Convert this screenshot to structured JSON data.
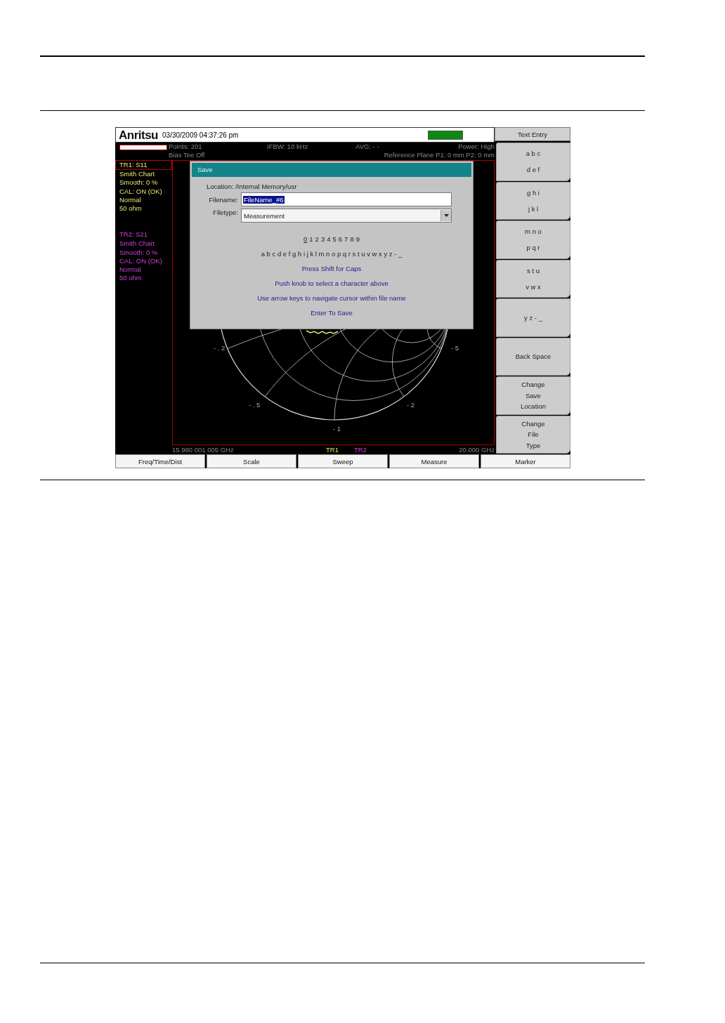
{
  "header": {
    "logo": "Anritsu",
    "datetime": "03/30/2009 04:37:26 pm"
  },
  "status": {
    "points": "Points: 201",
    "ifbw": "IFBW: 10 kHz",
    "avg": "AVG: - -",
    "power": "Power: High",
    "bias": "Bias Tee Off",
    "reference": "Reference Plane P1: 0 mm P2: 0 mm"
  },
  "traces": [
    {
      "selected": true,
      "color": "#e8e870",
      "lines": [
        "TR1: S11",
        "Smith Chart",
        "Smooth: 0 %",
        "CAL: ON (OK)",
        "Normal",
        "50 ohm"
      ]
    },
    {
      "selected": false,
      "color": "#d040d8",
      "lines": [
        "TR2: S21",
        "Smith Chart",
        "Smooth: 0 %",
        "CAL: ON (OK)",
        "Normal",
        "50 ohm"
      ]
    }
  ],
  "chart": {
    "labels": [
      "- . 2",
      "- 5",
      "- . 5",
      "- 2",
      "- 1"
    ],
    "start": "15.980 001 005 GHz",
    "stop": "20.000 GHz",
    "legend": [
      "TR1",
      "TR2"
    ]
  },
  "dialog": {
    "title": "Save",
    "location_label": "Location:",
    "location": "/Internal Memory/usr",
    "filename_label": "Filename:",
    "filename": "FileName_#6",
    "filetype_label": "Filetype:",
    "filetype": "Measurement",
    "digits": [
      {
        "char": "0",
        "selected": true
      },
      {
        "char": "1",
        "selected": false
      },
      {
        "char": "2",
        "selected": false
      },
      {
        "char": "3",
        "selected": false
      },
      {
        "char": "4",
        "selected": false
      },
      {
        "char": "5",
        "selected": false
      },
      {
        "char": "6",
        "selected": false
      },
      {
        "char": "7",
        "selected": false
      },
      {
        "char": "8",
        "selected": false
      },
      {
        "char": "9",
        "selected": false
      }
    ],
    "letters": "a b c d e f g h i j k l m n o p q r s t u v w x y z - _",
    "hints": [
      "Press Shift for Caps",
      "Push knob to select a character above",
      "Use arrow keys to navigate cursor within file name",
      "Enter To Save"
    ]
  },
  "softkeys": {
    "title": "Text Entry",
    "keys": [
      {
        "lines": [
          "a b c",
          "d e f"
        ]
      },
      {
        "lines": [
          "g h i",
          "j k l"
        ]
      },
      {
        "lines": [
          "m n o",
          "p q r"
        ]
      },
      {
        "lines": [
          "s t u",
          "v w x"
        ]
      },
      {
        "lines": [
          "y z - _"
        ]
      },
      {
        "lines": [
          "Back Space"
        ]
      },
      {
        "lines": [
          "Change",
          "Save",
          "Location"
        ]
      },
      {
        "lines": [
          "Change",
          "File",
          "Type"
        ]
      }
    ]
  },
  "menu": [
    "Freq/Time/Dist",
    "Scale",
    "Sweep",
    "Measure",
    "Marker"
  ]
}
